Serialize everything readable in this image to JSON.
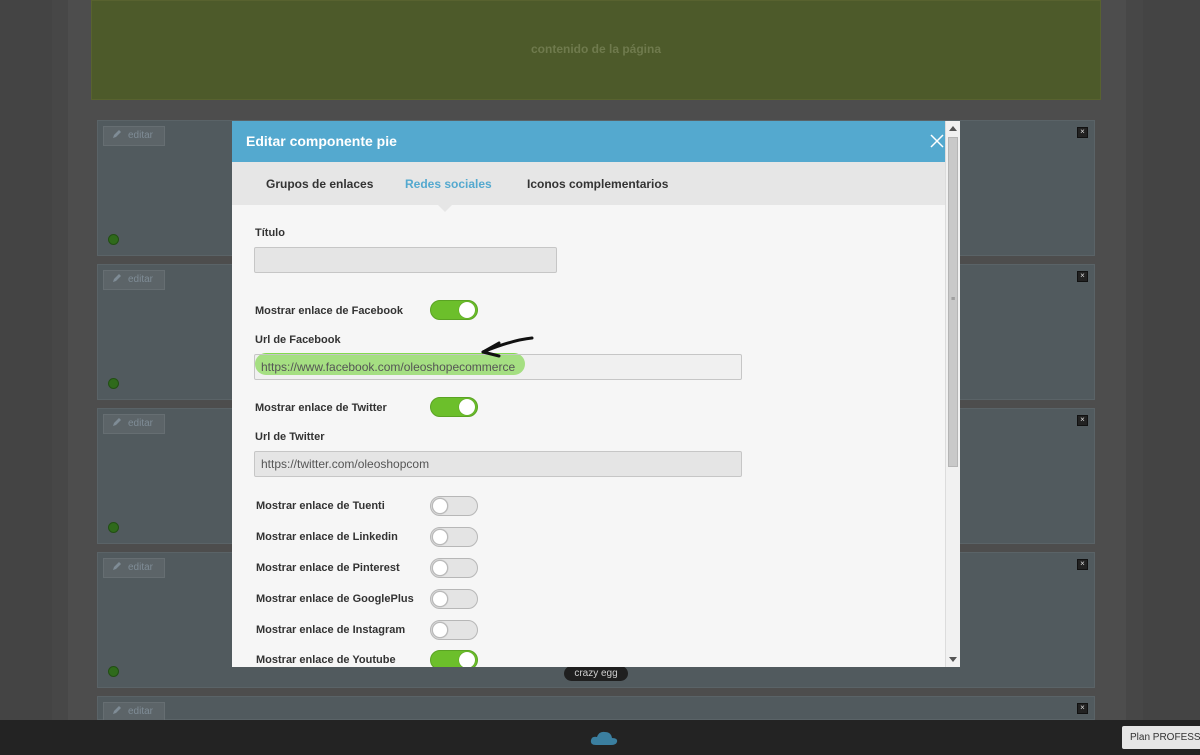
{
  "background_page": {
    "content_placeholder": "contenido de la página",
    "edit_label": "editar",
    "badge": "crazy egg",
    "plan_label": "Plan PROFESSIONAL"
  },
  "modal": {
    "title": "Editar componente pie",
    "tabs": [
      {
        "label": "Grupos de enlaces",
        "active": false
      },
      {
        "label": "Redes sociales",
        "active": true
      },
      {
        "label": "Iconos complementarios",
        "active": false
      }
    ],
    "titulo": {
      "label": "Título",
      "value": ""
    },
    "facebook": {
      "toggle_label": "Mostrar enlace de Facebook",
      "enabled": true,
      "url_label": "Url de Facebook",
      "url_value": "https://www.facebook.com/oleoshopecommerce"
    },
    "twitter": {
      "toggle_label": "Mostrar enlace de Twitter",
      "enabled": true,
      "url_label": "Url de Twitter",
      "url_value": "https://twitter.com/oleoshopcom"
    },
    "other_networks": [
      {
        "label": "Mostrar enlace de Tuenti",
        "enabled": false
      },
      {
        "label": "Mostrar enlace de Linkedin",
        "enabled": false
      },
      {
        "label": "Mostrar enlace de Pinterest",
        "enabled": false
      },
      {
        "label": "Mostrar enlace de GooglePlus",
        "enabled": false
      },
      {
        "label": "Mostrar enlace de Instagram",
        "enabled": false
      },
      {
        "label": "Mostrar enlace de Youtube",
        "enabled": true
      }
    ]
  },
  "colors": {
    "header": "#54a9cf",
    "active_tab": "#54a9cf",
    "toggle_on": "#6cbf2b",
    "toggle_off": "#e4e4e4"
  }
}
